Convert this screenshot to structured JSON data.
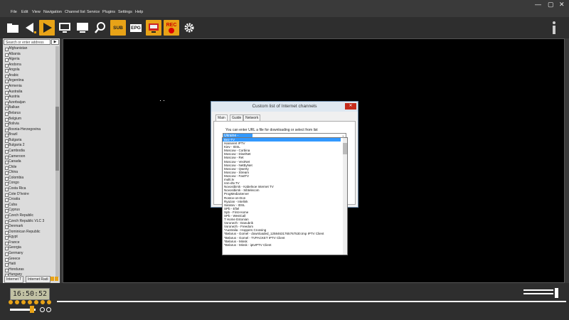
{
  "window": {
    "controls": [
      "—",
      "▢",
      "✕"
    ]
  },
  "menu": [
    "File",
    "Edit",
    "View",
    "Navigation",
    "Channel list",
    "Service",
    "Plugins",
    "Settings",
    "Help"
  ],
  "toolbar": {
    "sub_label": "SUB",
    "epg_label": "EPG",
    "rec_label": "REC"
  },
  "sidebar": {
    "search_placeholder": "Search or enter address",
    "search_button": "▶",
    "channels": [
      "Afghanistan",
      "Albania",
      "Algeria",
      "Andorra",
      "Angola",
      "Arabic",
      "Argentina",
      "Armenia",
      "Australia",
      "Austria",
      "Azerbaijan",
      "Balkan",
      "Belarus",
      "Belgium",
      "Bolivia",
      "Bosnia-Herzegovina",
      "Brazil",
      "Bulgaria",
      "Bulgaria 2",
      "Cambodia",
      "Cameroon",
      "Canada",
      "Chile",
      "China",
      "Colombia",
      "Congo",
      "Costa Rica",
      "Cote D'Ivoire",
      "Croatia",
      "Cuba",
      "Cyprus",
      "Czech Republic",
      "Czech Republic VLC 3",
      "Denmark",
      "Dominican Republic",
      "Egypt",
      "France",
      "Georgia",
      "Germany",
      "Greece",
      "Haiti",
      "Honduras",
      "Hungary"
    ],
    "tabs": [
      "Internet T",
      "Internet Radi"
    ]
  },
  "dialog": {
    "title": "Custom list of Internet channels",
    "close": "✕",
    "tabs": [
      "Main",
      "Guide",
      "Network"
    ],
    "prompt": "You can enter URL a file for downloading or select from list",
    "combo_value": "Ukraine - Bolshoper",
    "options": [
      "Bez-TV",
      "Hanseret IPTV",
      "Kiev - IDSL",
      "Moscow - Corbina",
      "Moscow - DiselNet",
      "Moscow - Ret",
      "Moscow - VectNet",
      "Moscow - NetByNet",
      "Moscow - Qwerty",
      "Moscow - Stream",
      "Moscow - FastTV",
      "multi.tv",
      "nnn-dtv.TV",
      "Novosibirsk - Kabelnoe Internet TV",
      "Novosibirsk - Sibtelecom",
      "ProgMediaServer",
      "Rostov-on-Don",
      "Ryazan - Intelink",
      "Saratov - IDSL",
      "SPb - Efiel",
      "Spb - First-Home",
      "SPb - WestCall",
      "T Home Estonian",
      "Voronezh - Danubrik",
      "Voronezh - Freedom",
      "*Australia - Hoppers Crossing",
      "*Belarus - Gomel - downloaded_12584631765767530.tmp IPTV Client",
      "*Belarus - Gomel - TVPACKET IPTV Client",
      "*Belarus - Minsk",
      "*Belarus - Minsk - iptvIPTV Client"
    ]
  },
  "player": {
    "time": "16:50:52"
  }
}
